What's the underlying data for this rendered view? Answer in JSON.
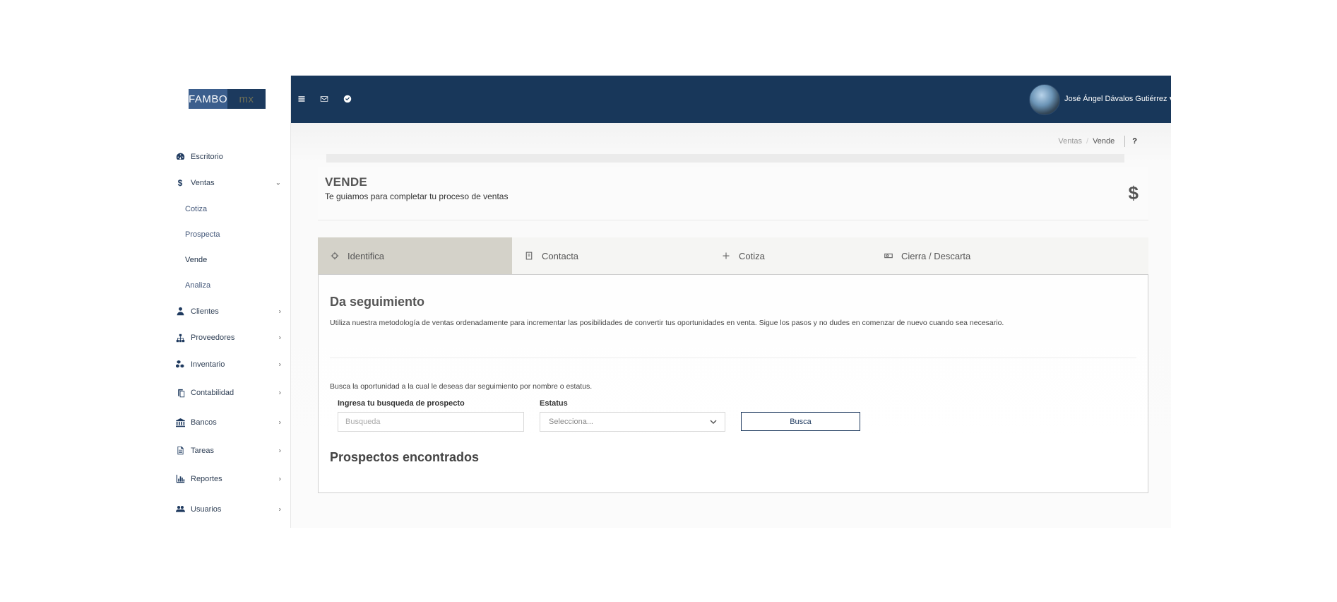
{
  "brand": {
    "logo_part1": "FAMBO",
    "logo_part2": "mx"
  },
  "sidebar": {
    "items": [
      {
        "label": "Escritorio",
        "icon": "dashboard-icon"
      },
      {
        "label": "Ventas",
        "icon": "dollar-icon",
        "expanded": true
      },
      {
        "label": "Clientes",
        "icon": "user-tie-icon"
      },
      {
        "label": "Proveedores",
        "icon": "sitemap-icon"
      },
      {
        "label": "Inventario",
        "icon": "cubes-icon"
      },
      {
        "label": "Contabilidad",
        "icon": "copy-icon"
      },
      {
        "label": "Bancos",
        "icon": "bank-icon"
      },
      {
        "label": "Tareas",
        "icon": "file-text-icon"
      },
      {
        "label": "Reportes",
        "icon": "bar-chart-icon"
      },
      {
        "label": "Usuarios",
        "icon": "users-icon"
      }
    ],
    "ventas_sub": [
      {
        "label": "Cotiza"
      },
      {
        "label": "Prospecta"
      },
      {
        "label": "Vende",
        "active": true
      },
      {
        "label": "Analiza"
      }
    ]
  },
  "topbar": {
    "user_name": "José Ángel Dávalos Gutiérrez",
    "color": "#18375a"
  },
  "breadcrumb": {
    "parent": "Ventas",
    "current": "Vende",
    "help": "?"
  },
  "header": {
    "title": "VENDE",
    "subtitle": "Te guiamos para completar tu proceso de ventas",
    "icon_glyph": "$"
  },
  "tabs": [
    {
      "label": "Identifica",
      "icon": "crosshair-icon",
      "active": true
    },
    {
      "label": "Contacta",
      "icon": "address-book-icon"
    },
    {
      "label": "Cotiza",
      "icon": "plus-icon"
    },
    {
      "label": "Cierra / Descarta",
      "icon": "money-icon"
    }
  ],
  "card": {
    "title": "Da seguimiento",
    "description": "Utiliza nuestra metodología de ventas ordenadamente para incrementar las posibilidades de convertir tus oportunidades en venta. Sigue los pasos y no dudes en comenzar de nuevo cuando sea necesario.",
    "search_hint": "Busca la oportunidad a la cual le deseas dar seguimiento por nombre o estatus.",
    "search_label": "Ingresa tu busqueda de prospecto",
    "search_placeholder": "Busqueda",
    "status_label": "Estatus",
    "status_value": "Selecciona...",
    "search_button": "Busca",
    "found_title": "Prospectos encontrados"
  }
}
